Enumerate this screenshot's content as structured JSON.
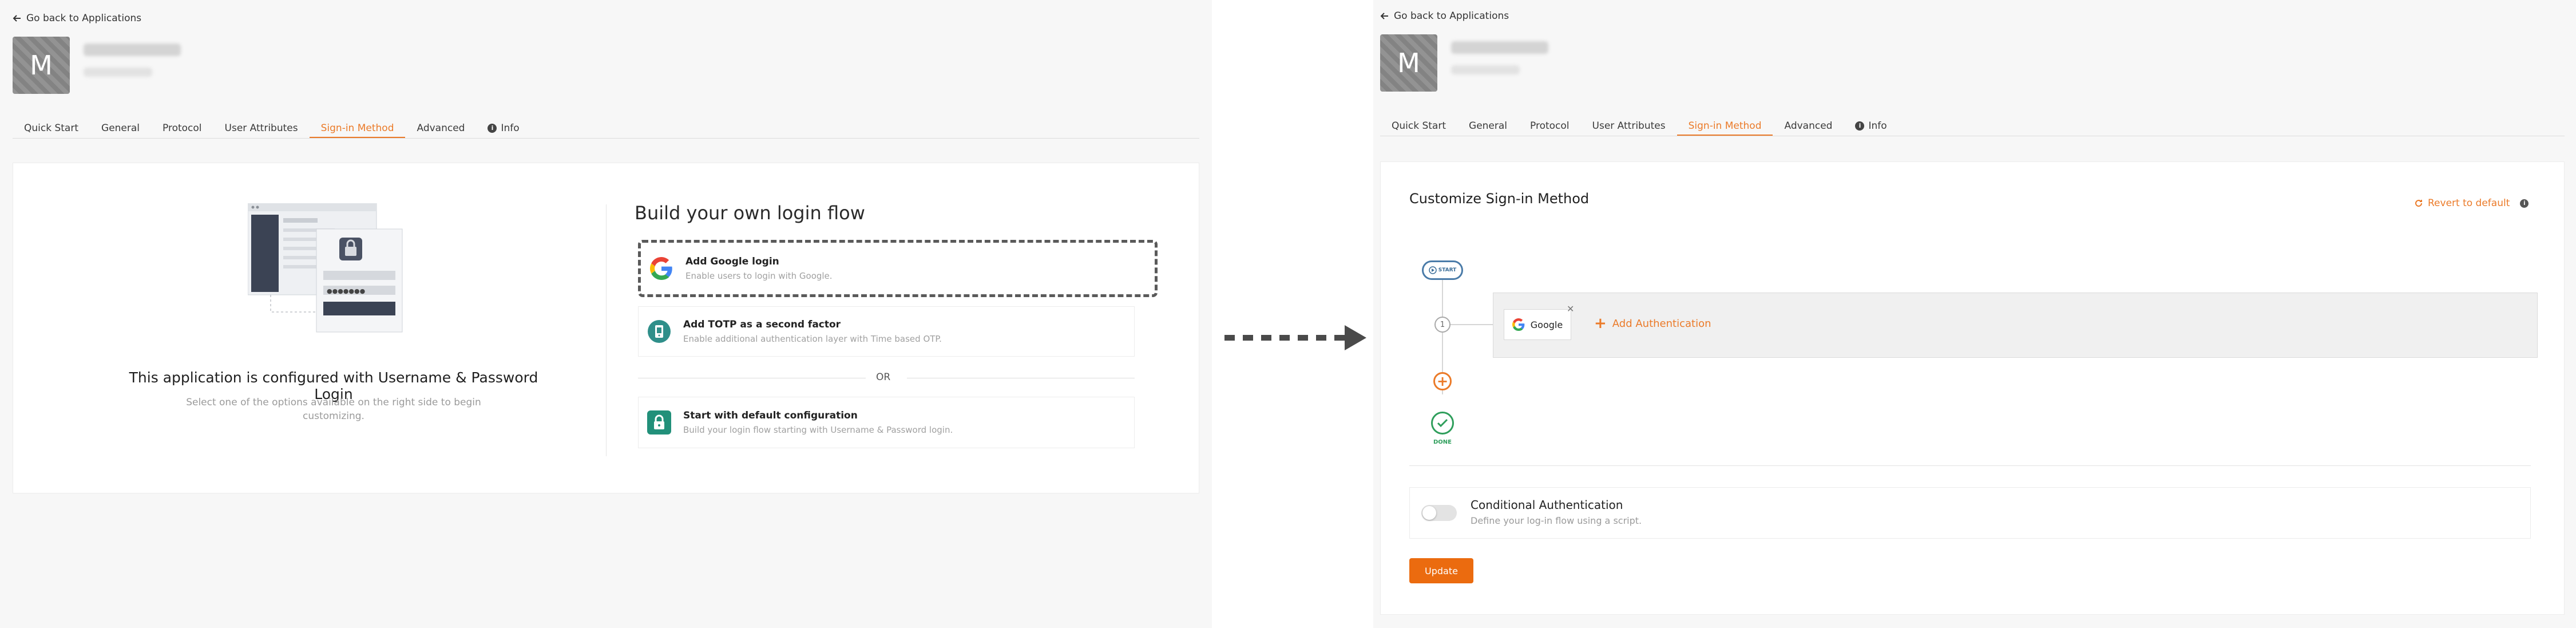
{
  "left": {
    "back_label": "Go back to Applications",
    "avatar_letter": "M",
    "tabs": [
      {
        "label": "Quick Start",
        "active": false
      },
      {
        "label": "General",
        "active": false
      },
      {
        "label": "Protocol",
        "active": false
      },
      {
        "label": "User Attributes",
        "active": false
      },
      {
        "label": "Sign-in Method",
        "active": true
      },
      {
        "label": "Advanced",
        "active": false
      },
      {
        "label": "Info",
        "active": false,
        "icon": "info-icon"
      }
    ],
    "configured_title": "This application is configured with Username & Password Login",
    "configured_subtitle_line1": "Select one of the options available on the right side to begin",
    "configured_subtitle_line2": "customizing.",
    "build_title": "Build your own login flow",
    "options": [
      {
        "title": "Add Google login",
        "subtitle": "Enable users to login with Google.",
        "icon": "google-icon"
      },
      {
        "title": "Add TOTP as a second factor",
        "subtitle": "Enable additional authentication layer with Time based OTP.",
        "icon": "totp-icon"
      },
      {
        "title": "Start with default configuration",
        "subtitle": "Build your login flow starting with Username & Password login.",
        "icon": "lock-icon"
      }
    ],
    "or_label": "OR"
  },
  "right": {
    "back_label": "Go back to Applications",
    "avatar_letter": "M",
    "tabs": [
      {
        "label": "Quick Start",
        "active": false
      },
      {
        "label": "General",
        "active": false
      },
      {
        "label": "Protocol",
        "active": false
      },
      {
        "label": "User Attributes",
        "active": false
      },
      {
        "label": "Sign-in Method",
        "active": true
      },
      {
        "label": "Advanced",
        "active": false
      },
      {
        "label": "Info",
        "active": false,
        "icon": "info-icon"
      }
    ],
    "customize_title": "Customize Sign-in Method",
    "revert_label": "Revert to default",
    "start_label": "START",
    "step_number": "1",
    "google_chip_label": "Google",
    "add_auth_label": "Add Authentication",
    "done_label": "DONE",
    "conditional_title": "Conditional Authentication",
    "conditional_subtitle": "Define your log-in flow using a script.",
    "update_label": "Update"
  },
  "colors": {
    "accent": "#eb7a28",
    "done_green": "#2e9e5b",
    "start_blue": "#4a7ba8"
  }
}
